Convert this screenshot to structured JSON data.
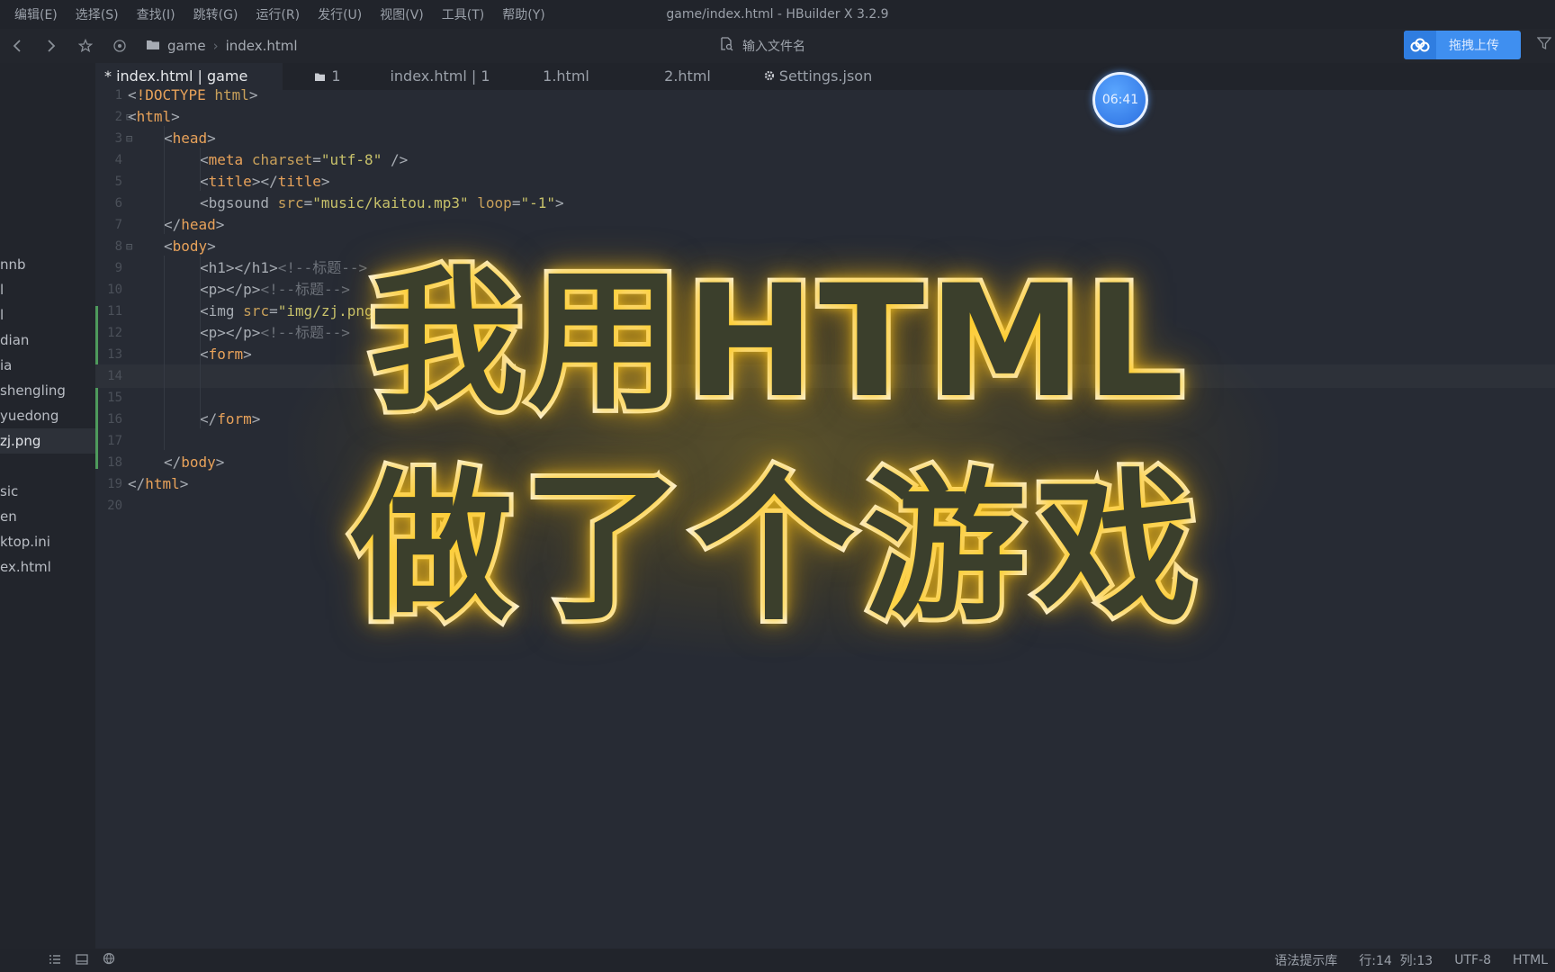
{
  "menubar": {
    "items": [
      "编辑(E)",
      "选择(S)",
      "查找(I)",
      "跳转(G)",
      "运行(R)",
      "发行(U)",
      "视图(V)",
      "工具(T)",
      "帮助(Y)"
    ],
    "window_title": "game/index.html - HBuilder X 3.2.9"
  },
  "toolbar": {
    "icons": [
      "back-icon",
      "forward-icon",
      "star-icon",
      "target-icon"
    ],
    "breadcrumb": [
      "game",
      "index.html"
    ],
    "search_placeholder": "输入文件名",
    "upload_label": "拖拽上传"
  },
  "sidebar": {
    "items": [
      {
        "label": "nnb"
      },
      {
        "label": "l"
      },
      {
        "label": "l"
      },
      {
        "label": "dian"
      },
      {
        "label": "ia"
      },
      {
        "label": "shengling"
      },
      {
        "label": "yuedong"
      },
      {
        "label": "zj.png",
        "active": true
      },
      {
        "label": "sic"
      },
      {
        "label": "en"
      },
      {
        "label": "ktop.ini"
      },
      {
        "label": "ex.html"
      }
    ]
  },
  "tabs": [
    {
      "label": "* index.html | game",
      "active": true
    },
    {
      "label": "1",
      "icon": "folder-icon"
    },
    {
      "label": "index.html | 1"
    },
    {
      "label": "1.html"
    },
    {
      "label": "2.html"
    },
    {
      "label": "Settings.json",
      "icon": "gear-icon"
    }
  ],
  "editor": {
    "current_line": 14,
    "lines": [
      {
        "n": "1",
        "indent": 0,
        "tokens": [
          [
            "pu",
            "<"
          ],
          [
            "tg",
            "!DOCTYPE"
          ],
          [
            "pu",
            " "
          ],
          [
            "at",
            "html"
          ],
          [
            "pu",
            ">"
          ]
        ]
      },
      {
        "n": "2",
        "indent": 0,
        "fold": true,
        "tokens": [
          [
            "pu",
            "<"
          ],
          [
            "tg",
            "html"
          ],
          [
            "pu",
            ">"
          ]
        ]
      },
      {
        "n": "3",
        "indent": 1,
        "fold": true,
        "tokens": [
          [
            "pu",
            "<"
          ],
          [
            "tg",
            "head"
          ],
          [
            "pu",
            ">"
          ]
        ]
      },
      {
        "n": "4",
        "indent": 2,
        "tokens": [
          [
            "pu",
            "<"
          ],
          [
            "tg",
            "meta"
          ],
          [
            "pu",
            " "
          ],
          [
            "at",
            "charset"
          ],
          [
            "pu",
            "="
          ],
          [
            "st",
            "\"utf-8\""
          ],
          [
            "pu",
            " />"
          ]
        ]
      },
      {
        "n": "5",
        "indent": 2,
        "tokens": [
          [
            "pu",
            "<"
          ],
          [
            "tg",
            "title"
          ],
          [
            "pu",
            "></"
          ],
          [
            "tg",
            "title"
          ],
          [
            "pu",
            ">"
          ]
        ]
      },
      {
        "n": "6",
        "indent": 2,
        "tokens": [
          [
            "pu",
            "<bgsound "
          ],
          [
            "at",
            "src"
          ],
          [
            "pu",
            "="
          ],
          [
            "st",
            "\"music/kaitou.mp3\""
          ],
          [
            "pu",
            " "
          ],
          [
            "at",
            "loop"
          ],
          [
            "pu",
            "="
          ],
          [
            "st",
            "\"-1\""
          ],
          [
            "pu",
            ">"
          ]
        ]
      },
      {
        "n": "7",
        "indent": 1,
        "tokens": [
          [
            "pu",
            "</"
          ],
          [
            "tg",
            "head"
          ],
          [
            "pu",
            ">"
          ]
        ]
      },
      {
        "n": "8",
        "indent": 1,
        "fold": true,
        "tokens": [
          [
            "pu",
            "<"
          ],
          [
            "tg",
            "body"
          ],
          [
            "pu",
            ">"
          ]
        ]
      },
      {
        "n": "9",
        "indent": 2,
        "tokens": [
          [
            "pu",
            "<h1></h1>"
          ],
          [
            "cm",
            "<!--标题-->"
          ]
        ]
      },
      {
        "n": "10",
        "indent": 2,
        "tokens": [
          [
            "pu",
            "<p></p>"
          ],
          [
            "cm",
            "<!--标题-->"
          ]
        ]
      },
      {
        "n": "11",
        "indent": 2,
        "tokens": [
          [
            "pu",
            "<img "
          ],
          [
            "at",
            "src"
          ],
          [
            "pu",
            "="
          ],
          [
            "st",
            "\"img/zj.png\""
          ],
          [
            "pu",
            ">"
          ]
        ]
      },
      {
        "n": "12",
        "indent": 2,
        "tokens": [
          [
            "pu",
            "<p></p>"
          ],
          [
            "cm",
            "<!--标题-->"
          ]
        ]
      },
      {
        "n": "13",
        "indent": 2,
        "tokens": [
          [
            "pu",
            "<"
          ],
          [
            "tg",
            "form"
          ],
          [
            "pu",
            ">"
          ]
        ]
      },
      {
        "n": "14",
        "indent": 0,
        "tokens": []
      },
      {
        "n": "15",
        "indent": 0,
        "tokens": []
      },
      {
        "n": "16",
        "indent": 2,
        "tokens": [
          [
            "pu",
            "</"
          ],
          [
            "tg",
            "form"
          ],
          [
            "pu",
            ">"
          ]
        ]
      },
      {
        "n": "17",
        "indent": 0,
        "tokens": []
      },
      {
        "n": "18",
        "indent": 1,
        "tokens": [
          [
            "pu",
            "</"
          ],
          [
            "tg",
            "body"
          ],
          [
            "pu",
            ">"
          ]
        ]
      },
      {
        "n": "19",
        "indent": 0,
        "tokens": [
          [
            "pu",
            "</"
          ],
          [
            "tg",
            "html"
          ],
          [
            "pu",
            ">"
          ]
        ]
      },
      {
        "n": "20",
        "indent": 0,
        "tokens": []
      }
    ]
  },
  "overlay": {
    "line1": "我用HTML",
    "line2": "做了个游戏"
  },
  "timer": "06:41",
  "statusbar": {
    "left_icons": [
      "list-icon",
      "panel-icon",
      "globe-icon"
    ],
    "hint": "语法提示库",
    "position": "行:14  列:13",
    "encoding": "UTF-8",
    "language": "HTML"
  },
  "colors": {
    "background": "#272b34",
    "tag": "#e8a25a",
    "string": "#c7c16a",
    "glow": "#ffd228",
    "upload_button": "#3f8ff0"
  }
}
